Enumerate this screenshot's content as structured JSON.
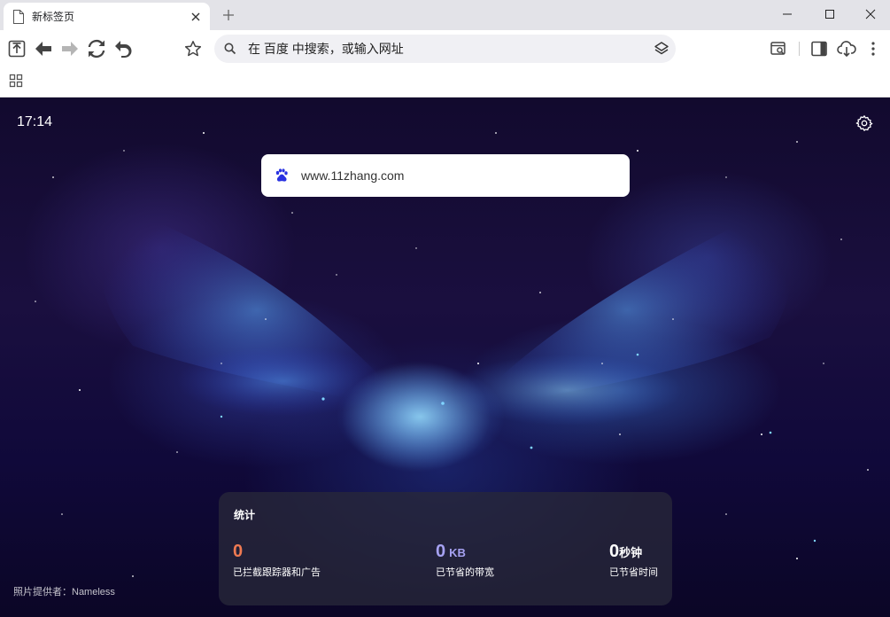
{
  "tab": {
    "title": "新标签页"
  },
  "omnibox": {
    "placeholder": "在 百度 中搜索，或输入网址"
  },
  "newtab": {
    "clock": "17:14",
    "search": {
      "value": "www.11zhang.com",
      "engine_icon": "baidu-paw-icon"
    },
    "photo_credit": "照片提供者：Nameless"
  },
  "stats": {
    "title": "统计",
    "items": [
      {
        "value": "0",
        "unit": "",
        "label": "已拦截跟踪器和广告"
      },
      {
        "value": "0",
        "unit": "KB",
        "label": "已节省的带宽"
      },
      {
        "value": "0",
        "unit": "秒钟",
        "label": "已节省时间"
      }
    ]
  },
  "colors": {
    "trackers": "#ef7a52",
    "bandwidth": "#a6a2f2",
    "time": "#ffffff",
    "baidu_blue": "#2932e1"
  }
}
